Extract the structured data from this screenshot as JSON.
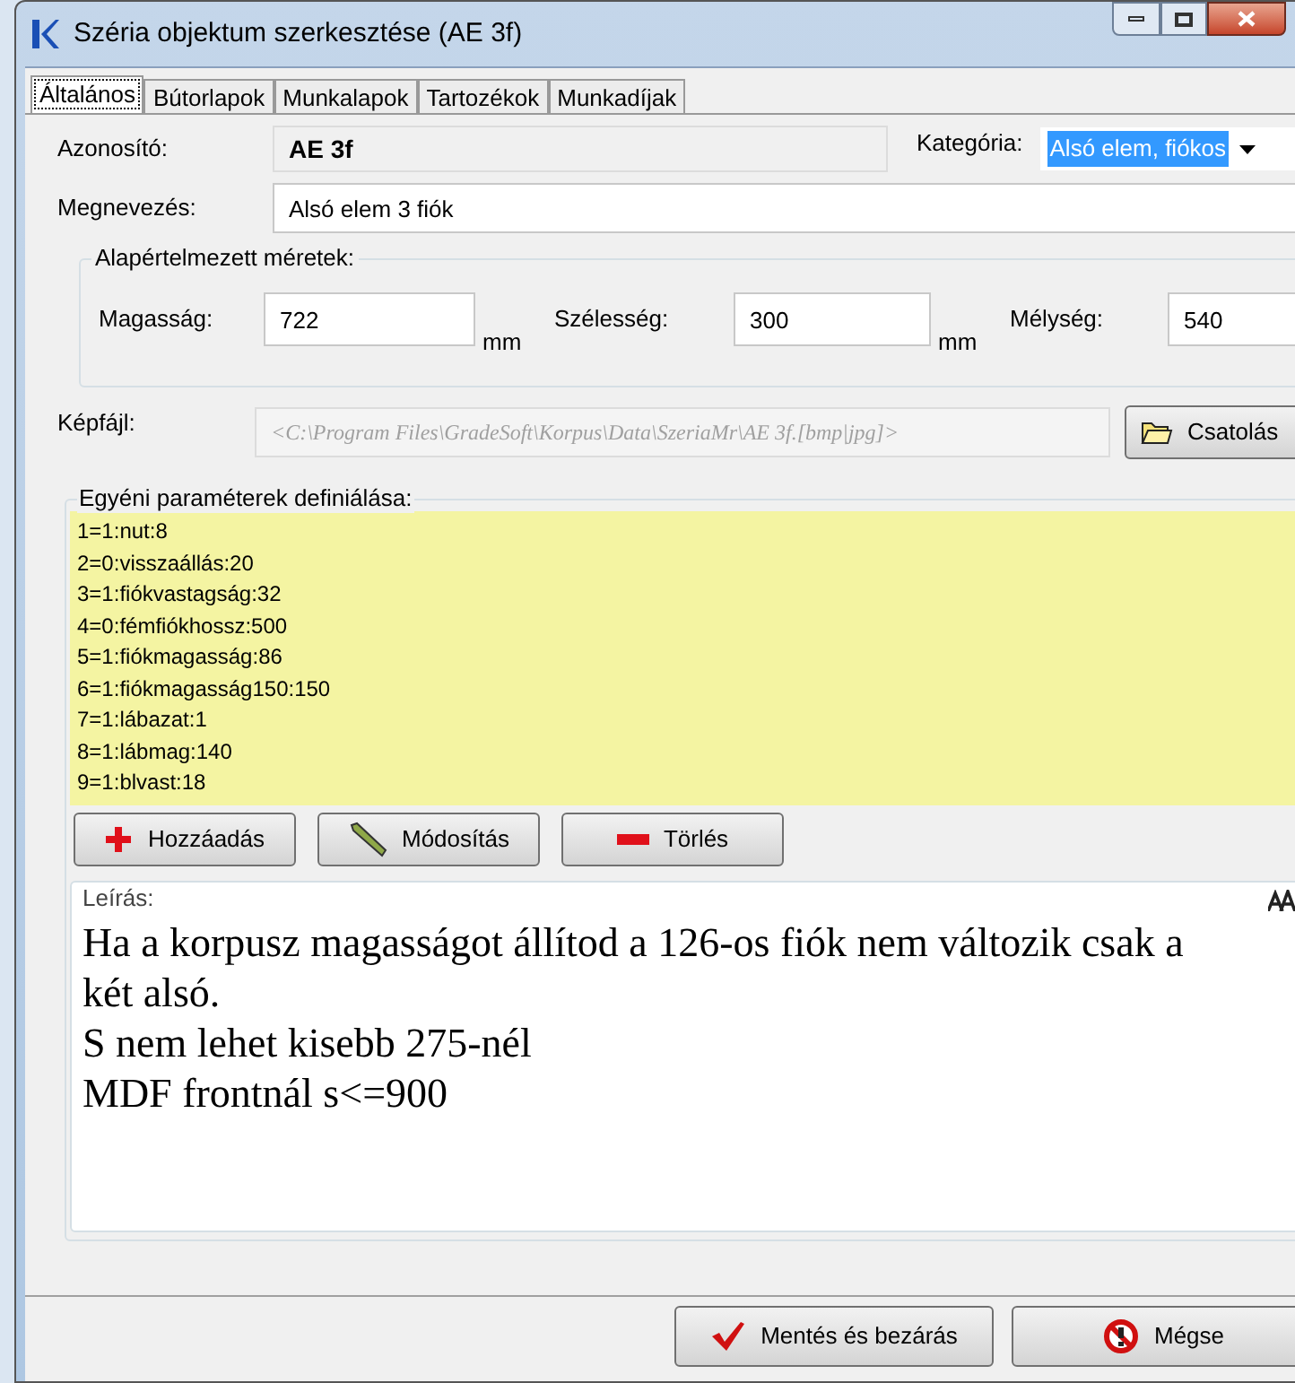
{
  "window": {
    "title": "Széria objektum szerkesztése (AE 3f)"
  },
  "tabs": [
    {
      "label": "Általános",
      "selected": true
    },
    {
      "label": "Bútorlapok",
      "selected": false
    },
    {
      "label": "Munkalapok",
      "selected": false
    },
    {
      "label": "Tartozékok",
      "selected": false
    },
    {
      "label": "Munkadíjak",
      "selected": false
    }
  ],
  "id_label": "Azonosító:",
  "id_value": "AE 3f",
  "category_label": "Kategória:",
  "category_value": "Alsó elem, fiókos",
  "name_label": "Megnevezés:",
  "name_value": "Alsó elem 3 fiók",
  "dimensions": {
    "title": "Alapértelmezett méretek:",
    "fields": [
      {
        "label": "Magasság:",
        "value": "722",
        "unit": "mm"
      },
      {
        "label": "Szélesség:",
        "value": "300",
        "unit": "mm"
      },
      {
        "label": "Mélység:",
        "value": "540"
      }
    ]
  },
  "image": {
    "label": "Képfájl:",
    "placeholder": "<C:\\Program Files\\GradeSoft\\Korpus\\Data\\SzeriaMr\\AE 3f.[bmp|jpg]>",
    "button": "Csatolás"
  },
  "params": {
    "title": "Egyéni paraméterek definiálása:",
    "items": [
      "1=1:nut:8",
      "2=0:visszaállás:20",
      "3=1:fiókvastagság:32",
      "4=0:fémfiókhossz:500",
      "5=1:fiókmagasság:86",
      "6=1:fiókmagasság150:150",
      "7=1:lábazat:1",
      "8=1:lábmag:140",
      "9=1:blvast:18"
    ],
    "buttons": [
      {
        "kind": "add",
        "label": "Hozzáadás"
      },
      {
        "kind": "edit",
        "label": "Módosítás"
      },
      {
        "kind": "delete",
        "label": "Törlés"
      }
    ]
  },
  "description": {
    "title": "Leírás:",
    "lines": [
      "Ha a korpusz magasságot állítod a 126-os fiók nem változik csak a két alsó.",
      "S nem lehet kisebb 275-nél",
      "MDF frontnál s<=900"
    ]
  },
  "footer_buttons": [
    {
      "kind": "save",
      "label": "Mentés és bezárás"
    },
    {
      "kind": "cancel",
      "label": "Mégse"
    }
  ]
}
